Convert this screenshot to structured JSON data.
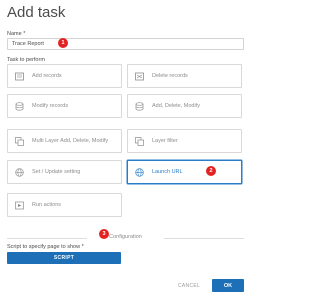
{
  "dialog": {
    "title": "Add task"
  },
  "name": {
    "label": "Name *",
    "value": "Trace Report"
  },
  "task": {
    "label": "Task to perform",
    "options": [
      {
        "label": "Add records",
        "icon": "add-records-icon",
        "selected": false
      },
      {
        "label": "Delete records",
        "icon": "delete-records-icon",
        "selected": false
      },
      {
        "label": "Modify records",
        "icon": "modify-records-icon",
        "selected": false
      },
      {
        "label": "Add, Delete, Modify",
        "icon": "add-delete-modify-icon",
        "selected": false
      },
      {
        "label": "Multi Layer Add, Delete, Modify",
        "icon": "multi-layer-icon",
        "selected": false
      },
      {
        "label": "Layer filter",
        "icon": "layer-filter-icon",
        "selected": false
      },
      {
        "label": "Set / Update setting",
        "icon": "settings-globe-icon",
        "selected": false
      },
      {
        "label": "Launch URL",
        "icon": "globe-icon",
        "selected": true
      },
      {
        "label": "Run actions",
        "icon": "run-actions-icon",
        "selected": false
      }
    ]
  },
  "configuration": {
    "heading": "Configuration",
    "script_label": "Script to specify page to show *",
    "script_button": "SCRIPT"
  },
  "footer": {
    "cancel": "CANCEL",
    "ok": "OK"
  },
  "badges": {
    "one": "1",
    "two": "2",
    "three": "3"
  },
  "colors": {
    "accent": "#1d6fb8",
    "selected_border": "#2b7cc7",
    "badge": "#e32222"
  }
}
